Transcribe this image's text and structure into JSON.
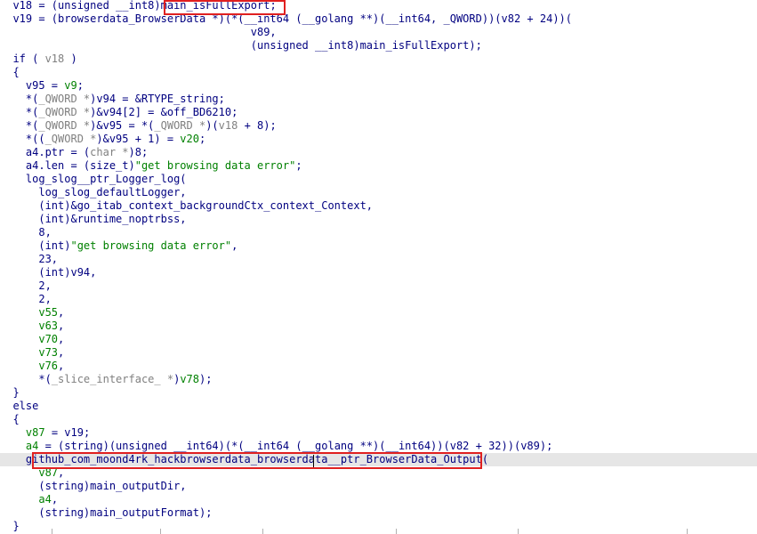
{
  "colors": {
    "operator": "#000080",
    "variable": "#008000",
    "type": "#808080",
    "string": "#008000",
    "highlight_box": "#e02020",
    "current_line": "#e6e6e6"
  },
  "lines": [
    [
      {
        "t": "  v18 = (unsigned __int8)",
        "c": "key"
      },
      {
        "t": "main_isFullExport;",
        "c": "dark"
      }
    ],
    [
      {
        "t": "  v19 = (browserdata_BrowserData *)(*(__int64 (__golang **)(__int64, _QWORD))(v82 + 24))(",
        "c": "key"
      }
    ],
    [
      {
        "t": "                                       v89,",
        "c": "key"
      }
    ],
    [
      {
        "t": "                                       (unsigned __int8)main_isFullExport);",
        "c": "key"
      }
    ],
    [
      {
        "t": "  if ( ",
        "c": "key"
      },
      {
        "t": "v18",
        "c": "gray"
      },
      {
        "t": " )",
        "c": "key"
      }
    ],
    [
      {
        "t": "  {",
        "c": "key"
      }
    ],
    [
      {
        "t": "    v95 = ",
        "c": "key"
      },
      {
        "t": "v9",
        "c": "var"
      },
      {
        "t": ";",
        "c": "key"
      }
    ],
    [
      {
        "t": "    *(",
        "c": "key"
      },
      {
        "t": "_QWORD *",
        "c": "gray"
      },
      {
        "t": ")v94 = &RTYPE_string;",
        "c": "key"
      }
    ],
    [
      {
        "t": "    *(",
        "c": "key"
      },
      {
        "t": "_QWORD *",
        "c": "gray"
      },
      {
        "t": ")&v94[2] = &off_BD6210;",
        "c": "key"
      }
    ],
    [
      {
        "t": "    *(",
        "c": "key"
      },
      {
        "t": "_QWORD *",
        "c": "gray"
      },
      {
        "t": ")&v95 = *(",
        "c": "key"
      },
      {
        "t": "_QWORD *",
        "c": "gray"
      },
      {
        "t": ")(",
        "c": "key"
      },
      {
        "t": "v18",
        "c": "gray"
      },
      {
        "t": " + 8);",
        "c": "key"
      }
    ],
    [
      {
        "t": "    *((",
        "c": "key"
      },
      {
        "t": "_QWORD *",
        "c": "gray"
      },
      {
        "t": ")&v95 + 1) = ",
        "c": "key"
      },
      {
        "t": "v20",
        "c": "var"
      },
      {
        "t": ";",
        "c": "key"
      }
    ],
    [
      {
        "t": "    a4.ptr = (",
        "c": "key"
      },
      {
        "t": "char *",
        "c": "gray"
      },
      {
        "t": ")8;",
        "c": "key"
      }
    ],
    [
      {
        "t": "    a4.len = (size_t)",
        "c": "key"
      },
      {
        "t": "\"get browsing data error\"",
        "c": "str"
      },
      {
        "t": ";",
        "c": "key"
      }
    ],
    [
      {
        "t": "    log_slog__ptr_Logger_log(",
        "c": "key"
      }
    ],
    [
      {
        "t": "      log_slog_defaultLogger,",
        "c": "key"
      }
    ],
    [
      {
        "t": "      (int)&go_itab_context_backgroundCtx_context_Context,",
        "c": "key"
      }
    ],
    [
      {
        "t": "      (int)&runtime_noptrbss,",
        "c": "key"
      }
    ],
    [
      {
        "t": "      8,",
        "c": "key"
      }
    ],
    [
      {
        "t": "      (int)",
        "c": "key"
      },
      {
        "t": "\"get browsing data error\"",
        "c": "str"
      },
      {
        "t": ",",
        "c": "key"
      }
    ],
    [
      {
        "t": "      23,",
        "c": "key"
      }
    ],
    [
      {
        "t": "      (int)v94,",
        "c": "key"
      }
    ],
    [
      {
        "t": "      2,",
        "c": "key"
      }
    ],
    [
      {
        "t": "      2,",
        "c": "key"
      }
    ],
    [
      {
        "t": "      ",
        "c": "key"
      },
      {
        "t": "v55",
        "c": "var"
      },
      {
        "t": ",",
        "c": "key"
      }
    ],
    [
      {
        "t": "      ",
        "c": "key"
      },
      {
        "t": "v63",
        "c": "var"
      },
      {
        "t": ",",
        "c": "key"
      }
    ],
    [
      {
        "t": "      ",
        "c": "key"
      },
      {
        "t": "v70",
        "c": "var"
      },
      {
        "t": ",",
        "c": "key"
      }
    ],
    [
      {
        "t": "      ",
        "c": "key"
      },
      {
        "t": "v73",
        "c": "var"
      },
      {
        "t": ",",
        "c": "key"
      }
    ],
    [
      {
        "t": "      ",
        "c": "key"
      },
      {
        "t": "v76",
        "c": "var"
      },
      {
        "t": ",",
        "c": "key"
      }
    ],
    [
      {
        "t": "      *(",
        "c": "key"
      },
      {
        "t": "_slice_interface_ *",
        "c": "gray"
      },
      {
        "t": ")",
        "c": "key"
      },
      {
        "t": "v78",
        "c": "var"
      },
      {
        "t": ");",
        "c": "key"
      }
    ],
    [
      {
        "t": "  }",
        "c": "key"
      }
    ],
    [
      {
        "t": "  else",
        "c": "key"
      }
    ],
    [
      {
        "t": "  {",
        "c": "key"
      }
    ],
    [
      {
        "t": "    ",
        "c": "key"
      },
      {
        "t": "v87",
        "c": "var"
      },
      {
        "t": " = v19;",
        "c": "key"
      }
    ],
    [
      {
        "t": "    ",
        "c": "key"
      },
      {
        "t": "a4",
        "c": "var"
      },
      {
        "t": " = (string)(unsigned __int64)(*(__int64 (__golang **)(__int64))(v82 + 32))(v89);",
        "c": "key"
      }
    ],
    [
      {
        "t": "    github_com_moond4rk_hackbrowserdata_browserdata__ptr_BrowserData_Output(",
        "c": "key"
      }
    ],
    [
      {
        "t": "      ",
        "c": "key"
      },
      {
        "t": "v87",
        "c": "var"
      },
      {
        "t": ",",
        "c": "key"
      }
    ],
    [
      {
        "t": "      (string)main_outputDir,",
        "c": "key"
      }
    ],
    [
      {
        "t": "      ",
        "c": "key"
      },
      {
        "t": "a4",
        "c": "var"
      },
      {
        "t": ",",
        "c": "key"
      }
    ],
    [
      {
        "t": "      (string)main_outputFormat);",
        "c": "key"
      }
    ],
    [
      {
        "t": "  }",
        "c": "key"
      }
    ]
  ],
  "annotations": [
    {
      "label": "main_isFullExport;"
    },
    {
      "label": "github_com_moond4rk_hackbrowserdata_browserdata__ptr_BrowserData_Output("
    }
  ]
}
